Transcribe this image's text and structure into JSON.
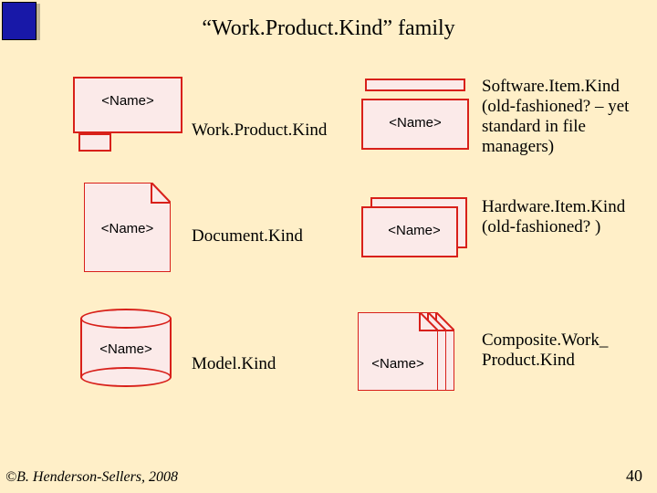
{
  "slide": {
    "title": "“Work.Product.Kind” family",
    "page_number": "40",
    "copyright": "©B. Henderson-Sellers, 2008"
  },
  "placeholder": "<Name>",
  "left": {
    "work_product_kind": "Work.Product.Kind",
    "document_kind": "Document.Kind",
    "model_kind": "Model.Kind"
  },
  "right": {
    "software_item_kind": "Software.Item.Kind (old-fashioned? – yet standard in file managers)",
    "hardware_item_kind": "Hardware.Item.Kind (old-fashioned? )",
    "composite_work_product_kind": "Composite.Work_ Product.Kind"
  }
}
